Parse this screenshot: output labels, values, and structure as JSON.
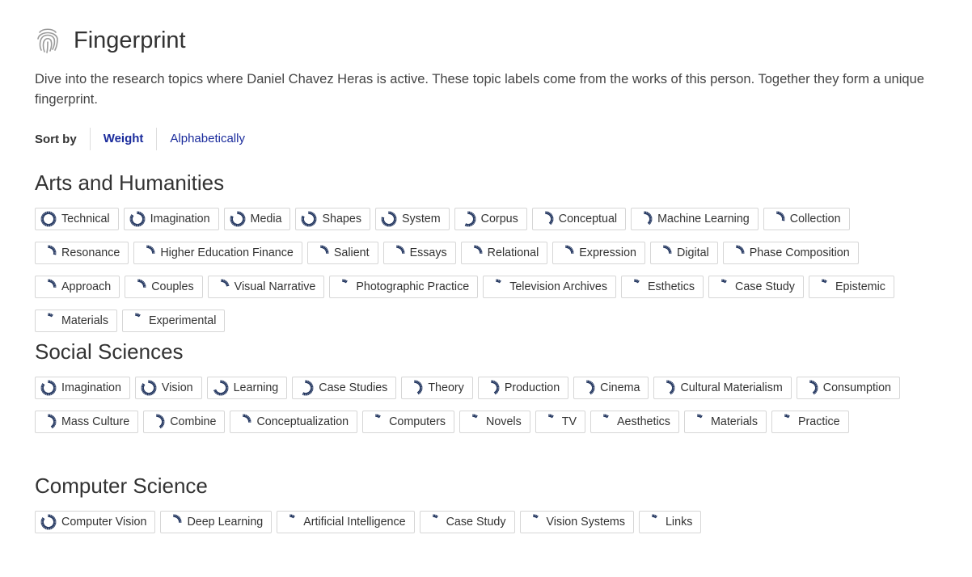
{
  "header": {
    "title": "Fingerprint",
    "icon": "fingerprint-icon"
  },
  "description": "Dive into the research topics where Daniel Chavez Heras is active. These topic labels come from the works of this person. Together they form a unique fingerprint.",
  "sort": {
    "label": "Sort by",
    "options": [
      "Weight",
      "Alphabetically"
    ],
    "selected": "Weight"
  },
  "colors": {
    "accent": "#1a2b9c",
    "weight_ring": "#1b2f5a",
    "chip_border": "#d6d6d6"
  },
  "sections": [
    {
      "title": "Arts and Humanities",
      "topics": [
        {
          "label": "Technical",
          "weight": 1.0
        },
        {
          "label": "Imagination",
          "weight": 0.87
        },
        {
          "label": "Media",
          "weight": 0.85
        },
        {
          "label": "Shapes",
          "weight": 0.83
        },
        {
          "label": "System",
          "weight": 0.8
        },
        {
          "label": "Corpus",
          "weight": 0.6
        },
        {
          "label": "Conceptual",
          "weight": 0.42
        },
        {
          "label": "Machine Learning",
          "weight": 0.42
        },
        {
          "label": "Collection",
          "weight": 0.3
        },
        {
          "label": "Resonance",
          "weight": 0.3
        },
        {
          "label": "Higher Education Finance",
          "weight": 0.28
        },
        {
          "label": "Salient",
          "weight": 0.28
        },
        {
          "label": "Essays",
          "weight": 0.28
        },
        {
          "label": "Relational",
          "weight": 0.28
        },
        {
          "label": "Expression",
          "weight": 0.28
        },
        {
          "label": "Digital",
          "weight": 0.28
        },
        {
          "label": "Phase Composition",
          "weight": 0.28
        },
        {
          "label": "Approach",
          "weight": 0.28
        },
        {
          "label": "Couples",
          "weight": 0.28
        },
        {
          "label": "Visual Narrative",
          "weight": 0.26
        },
        {
          "label": "Photographic Practice",
          "weight": 0.14
        },
        {
          "label": "Television Archives",
          "weight": 0.14
        },
        {
          "label": "Esthetics",
          "weight": 0.14
        },
        {
          "label": "Case Study",
          "weight": 0.14
        },
        {
          "label": "Epistemic",
          "weight": 0.14
        },
        {
          "label": "Materials",
          "weight": 0.14
        },
        {
          "label": "Experimental",
          "weight": 0.14
        }
      ]
    },
    {
      "title": "Social Sciences",
      "topics": [
        {
          "label": "Imagination",
          "weight": 0.88
        },
        {
          "label": "Vision",
          "weight": 0.86
        },
        {
          "label": "Learning",
          "weight": 0.72
        },
        {
          "label": "Case Studies",
          "weight": 0.58
        },
        {
          "label": "Theory",
          "weight": 0.44
        },
        {
          "label": "Production",
          "weight": 0.44
        },
        {
          "label": "Cinema",
          "weight": 0.43
        },
        {
          "label": "Cultural Materialism",
          "weight": 0.43
        },
        {
          "label": "Consumption",
          "weight": 0.43
        },
        {
          "label": "Mass Culture",
          "weight": 0.43
        },
        {
          "label": "Combine",
          "weight": 0.43
        },
        {
          "label": "Conceptualization",
          "weight": 0.28
        },
        {
          "label": "Computers",
          "weight": 0.14
        },
        {
          "label": "Novels",
          "weight": 0.14
        },
        {
          "label": "TV",
          "weight": 0.14
        },
        {
          "label": "Aesthetics",
          "weight": 0.14
        },
        {
          "label": "Materials",
          "weight": 0.14
        },
        {
          "label": "Practice",
          "weight": 0.14
        }
      ]
    },
    {
      "title": "Computer Science",
      "topics": [
        {
          "label": "Computer Vision",
          "weight": 0.88
        },
        {
          "label": "Deep Learning",
          "weight": 0.28
        },
        {
          "label": "Artificial Intelligence",
          "weight": 0.14
        },
        {
          "label": "Case Study",
          "weight": 0.14
        },
        {
          "label": "Vision Systems",
          "weight": 0.14
        },
        {
          "label": "Links",
          "weight": 0.14
        }
      ]
    }
  ]
}
